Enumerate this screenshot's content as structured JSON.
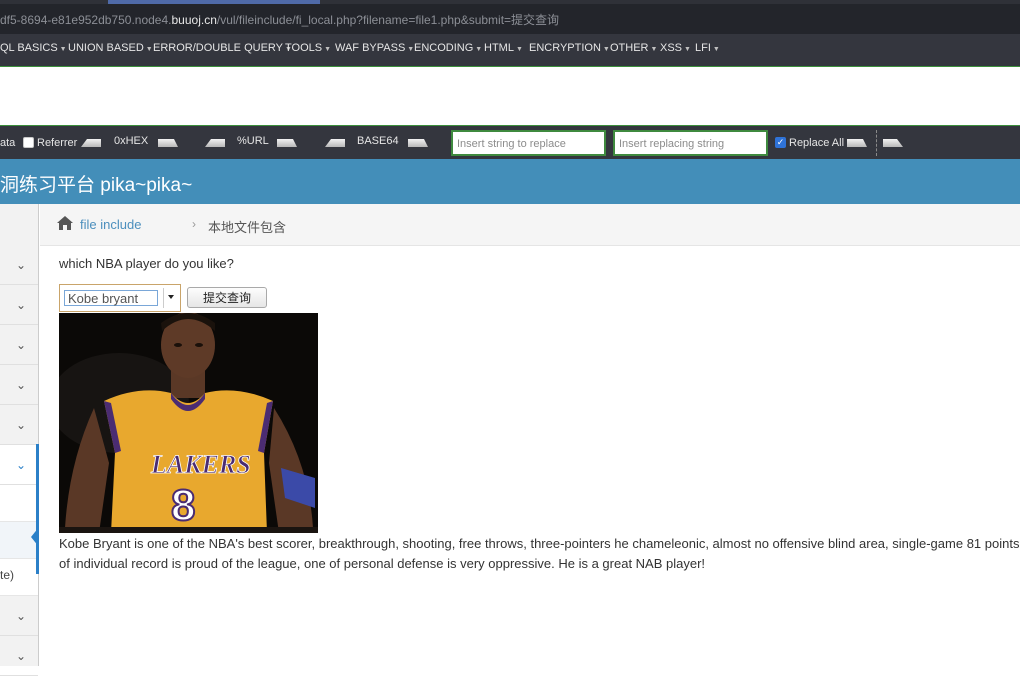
{
  "browser": {
    "url_prefix": "df5-8694-e81e952db750.node4.",
    "url_host": "buuoj.cn",
    "url_path": "/vul/fileinclude/fi_local.php?filename=file1.php&submit=提交查询"
  },
  "hackbar": {
    "menu": [
      "QL BASICS",
      "UNION BASED",
      "ERROR/DOUBLE QUERY",
      "TOOLS",
      "WAF BYPASS",
      "ENCODING",
      "HTML",
      "ENCRYPTION",
      "OTHER",
      "XSS",
      "LFI"
    ],
    "post_data_label": "ata",
    "referrer_label": "Referrer",
    "referrer_checked": false,
    "hex_label": "0xHEX",
    "url_label": "%URL",
    "base64_label": "BASE64",
    "replace_placeholder": "Insert string to replace",
    "replacing_placeholder": "Insert replacing string",
    "replace_all_label": "Replace All",
    "replace_all_checked": true
  },
  "site": {
    "title": "洞练习平台 pika~pika~",
    "header_color": "#438eb9"
  },
  "sidebar": {
    "partial_text": "te)"
  },
  "breadcrumb": {
    "home_icon": "home-icon",
    "link": "file include",
    "separator": "›",
    "current": "本地文件包含"
  },
  "main": {
    "question": "which NBA player do you like?",
    "select_value": "Kobe bryant",
    "submit_label": "提交查询",
    "image_alt": "kobe-bryant-lakers-8-photo",
    "description": "Kobe Bryant is one of the NBA's best scorer, breakthrough, shooting, free throws, three-pointers he chameleonic, almost no offensive blind area, single-game 81 points of individual record is proud of the league, one of personal defense is very oppressive. He is a great NAB player!"
  },
  "colors": {
    "hackbar_bg": "#34363e",
    "accent_green": "#3f8a3f",
    "link_blue": "#4c8fbd"
  }
}
